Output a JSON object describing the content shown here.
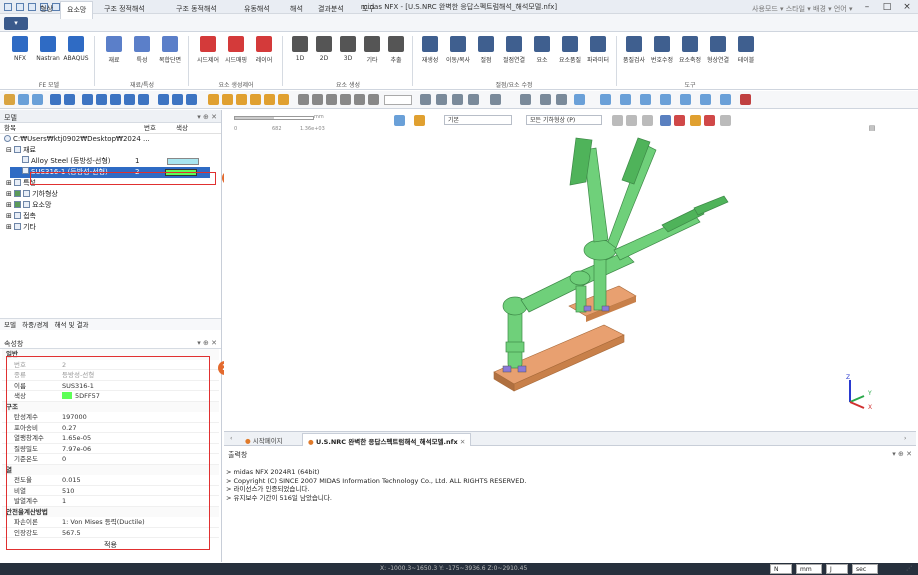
{
  "window": {
    "title": "midas NFX - [U.S.NRC 완벽한 응답스펙트럼해석_해석모델.nfx]",
    "right_menu": "사용모드 ▾ 스타일 ▾ 배경 ▾ 언어 ▾"
  },
  "ribbon": {
    "tabs": [
      "형상",
      "요소망",
      "구조 정적해석",
      "구조 동적해석",
      "유동해석",
      "해석",
      "결과분석",
      "도구"
    ],
    "active_tab": "요소망",
    "groups": [
      {
        "name": "FE 모델",
        "buttons": [
          "NFX",
          "Nastran",
          "ABAQUS"
        ]
      },
      {
        "name": "재료/특성",
        "buttons": [
          "재료",
          "특성",
          "복합단면"
        ]
      },
      {
        "name": "요소 생성제어",
        "buttons": [
          "시드제어",
          "시드매핑",
          "레이어"
        ]
      },
      {
        "name": "요소 생성",
        "buttons": [
          "1D",
          "2D",
          "3D",
          "기타",
          "추출"
        ]
      },
      {
        "name": "절점/요소 수정",
        "buttons": [
          "재생성",
          "이동/복사",
          "절점",
          "절점연결",
          "요소",
          "요소품질",
          "파라미터"
        ]
      },
      {
        "name": "도구",
        "buttons": [
          "품질검사",
          "번호수정",
          "요소축정",
          "형상연결",
          "테이블"
        ]
      }
    ],
    "toolbar_zoom": "15"
  },
  "model_tree": {
    "header": "모델",
    "columns": [
      "항목",
      "번호",
      "색상"
    ],
    "path": "C:₩Users₩ktj0902₩Desktop₩2024 ...",
    "items": [
      {
        "label": "재료",
        "indent": 1
      },
      {
        "label": "Alloy Steel (등방성-선형)",
        "num": "1",
        "color": "#A8E6F0",
        "indent": 2
      },
      {
        "label": "SUS316-1 (등방성-선형)",
        "num": "2",
        "color": "#5DFF57",
        "indent": 2,
        "selected": true
      },
      {
        "label": "특성",
        "indent": 1
      },
      {
        "label": "기하형상",
        "indent": 1
      },
      {
        "label": "요소망",
        "indent": 1
      },
      {
        "label": "접촉",
        "indent": 1
      },
      {
        "label": "기타",
        "indent": 1
      }
    ],
    "bottom_tabs": [
      "모델",
      "하중/경계",
      "해석 및 결과"
    ]
  },
  "properties": {
    "header": "속성창",
    "sections": [
      {
        "name": "일반",
        "rows": [
          {
            "k": "번호",
            "v": "2",
            "dim": true
          },
          {
            "k": "종류",
            "v": "등방성-선형",
            "dim": true
          },
          {
            "k": "이름",
            "v": "SUS316-1"
          },
          {
            "k": "색상",
            "v": "5DFF57",
            "swatch": "#5DFF57"
          }
        ]
      },
      {
        "name": "구조",
        "rows": [
          {
            "k": "탄성계수",
            "v": "197000"
          },
          {
            "k": "포아송비",
            "v": "0.27"
          },
          {
            "k": "열팽창계수",
            "v": "1.65e-05"
          },
          {
            "k": "질량밀도",
            "v": "7.97e-06"
          },
          {
            "k": "기준온도",
            "v": "0"
          }
        ]
      },
      {
        "name": "열",
        "rows": [
          {
            "k": "전도율",
            "v": "0.015"
          },
          {
            "k": "비열",
            "v": "510"
          },
          {
            "k": "발열계수",
            "v": "1"
          }
        ]
      },
      {
        "name": "안전율계산방법",
        "rows": [
          {
            "k": "파손이론",
            "v": "1: Von Mises 등력(Ductile)"
          },
          {
            "k": "인장강도",
            "v": "567.5"
          }
        ]
      }
    ],
    "apply_label": "적용"
  },
  "viewport": {
    "scale_left": "0",
    "scale_mid": "682",
    "scale_right": "1.36e+03",
    "scale_unit": "mm",
    "view_mode": "기본",
    "geometry_filter": "모든 기하형상 (P)",
    "axis_labels": [
      "Z",
      "Y",
      "X"
    ]
  },
  "doc_tabs": [
    "시작페이지",
    "U.S.NRC 완벽한 응답스펙트럼해석_해석모델.nfx"
  ],
  "output": {
    "header": "출력창",
    "lines": [
      "> midas NFX 2024R1 (64bit)",
      "> Copyright (C) SINCE 2007 MIDAS Information Technology Co., Ltd. ALL RIGHTS RESERVED.",
      "> 라이선스가 인증되었습니다.",
      "> 유지보수 기간이 516일 남았습니다."
    ]
  },
  "status": {
    "coords": "X: -1000.3~1650.3 Y: -175~3936.6 Z:0~2910.45",
    "fields": [
      "N",
      "mm",
      "J",
      "sec"
    ]
  },
  "badges": [
    "1",
    "2"
  ],
  "colors": {
    "accent": "#2F6BC4",
    "badge": "#E36A2E",
    "pipe": "#6FD07A",
    "base": "#E8A070"
  }
}
